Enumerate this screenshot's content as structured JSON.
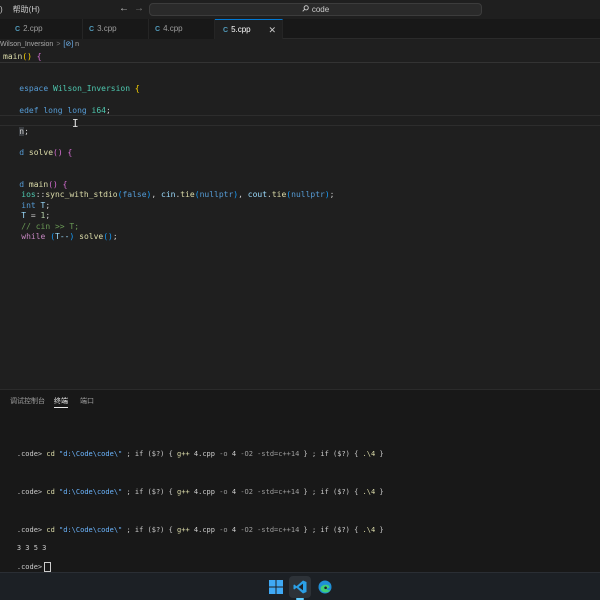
{
  "titlebar": {
    "menu_partial": ")",
    "menu_help": "帮助(H)",
    "search_text": "code",
    "search_icon": "search-icon",
    "back_icon": "arrow-left-icon",
    "forward_icon": "arrow-right-icon"
  },
  "tabs": [
    {
      "label": "2.cpp",
      "active": false
    },
    {
      "label": "3.cpp",
      "active": false
    },
    {
      "label": "4.cpp",
      "active": false
    },
    {
      "label": "5.cpp",
      "active": true
    }
  ],
  "tab_close_glyph": "✕",
  "breadcrumb": {
    "namespace": "Wilson_Inversion",
    "symbol": "n",
    "separator": ">"
  },
  "sticky_scroll": {
    "name": "main",
    "parens": "()",
    "brace": "{"
  },
  "editor": {
    "l1": {
      "kw": "espace",
      "ns": "Wilson_Inversion",
      "brace": "{"
    },
    "l3": {
      "kw": "edef",
      "kw2": "long long",
      "ty": "i64",
      "semi": ";"
    },
    "l5": {
      "cursor_char": "n",
      "semi": ";"
    },
    "l7": {
      "kw": "d",
      "fn": "solve",
      "parens": "()",
      "brace": "{"
    },
    "l10": {
      "kw": "d",
      "fn": "main",
      "parens": "()",
      "brace": "{"
    },
    "l11": {
      "ns": "ios",
      "op": "::",
      "fn1": "sync_with_stdio",
      "p1": "(",
      "arg1": "false",
      "p2": ")",
      "comma": ", ",
      "v1": "cin",
      "dot": ".",
      "fn2": "tie",
      "p3": "(",
      "arg2": "nullptr",
      "p4": ")",
      "comma2": ", ",
      "v2": "cout",
      "dot2": ".",
      "fn3": "tie",
      "p5": "(",
      "arg3": "nullptr",
      "p6": ")",
      "semi": ";"
    },
    "l12": {
      "kw": "int",
      "var": "T",
      "semi": ";"
    },
    "l13": {
      "var": "T",
      "op": " = ",
      "num": "1",
      "semi": ";"
    },
    "l14": {
      "cmt": "// cin >> T;"
    },
    "l15": {
      "ctl": "while",
      "p1": "(",
      "var": "T--",
      "p2": ")",
      "fn": "solve",
      "parens": "()",
      "semi": ";"
    }
  },
  "panel": {
    "tabs": [
      "调试控制台",
      "终端",
      "端口"
    ],
    "active_tab": "终端",
    "terminal": {
      "prompt": ".code>",
      "cmd": "cd",
      "path": "\"d:\\Code\\code\\\"",
      "mid1": " ; if ($?) { ",
      "compiler": "g++",
      "src": " 4.cpp ",
      "flag_o": "-o",
      "out": " 4 ",
      "flags": "-O2 -std=c++14",
      "mid2": " } ; if ($?) { ",
      "run": ".\\4",
      "end": " }",
      "output": "3 3 5 3"
    }
  },
  "taskbar": {
    "apps": [
      "windows-start-icon",
      "vscode-icon",
      "edge-icon"
    ]
  }
}
